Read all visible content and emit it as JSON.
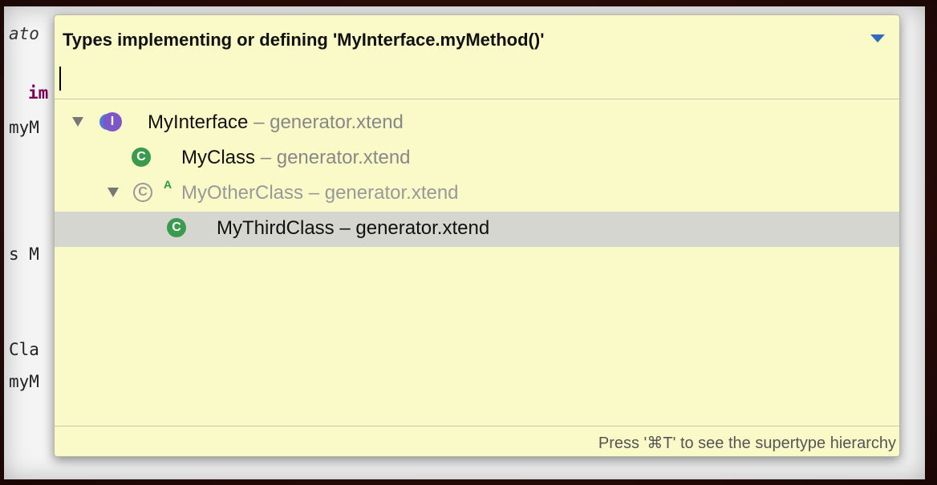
{
  "editor": {
    "lines": [
      "ato",
      "im",
      "myM",
      "s M",
      "Cla",
      "myM"
    ]
  },
  "popup": {
    "title": "Types implementing or defining 'MyInterface.myMethod()'",
    "filter_value": "",
    "status": "Press '⌘T' to see the supertype hierarchy",
    "items": [
      {
        "name": "MyInterface",
        "separator": "–",
        "location": "generator.xtend",
        "kind": "interface-icon",
        "expanded": true
      },
      {
        "name": "MyClass",
        "separator": "–",
        "location": "generator.xtend",
        "kind": "class-icon"
      },
      {
        "name": "MyOtherClass",
        "separator": "–",
        "location": "generator.xtend",
        "kind": "abstract-class-icon",
        "expanded": true,
        "abstract_mark": "A"
      },
      {
        "name": "MyThirdClass",
        "separator": "–",
        "location": "generator.xtend",
        "kind": "class-icon",
        "selected": true
      }
    ],
    "icon_glyphs": {
      "interface": "I",
      "class": "C"
    }
  },
  "colors": {
    "popup_bg": "#fafac8",
    "selection": "#d6d6d0",
    "class_icon": "#3a9a4e",
    "interface_icon": "#7d57c8",
    "menu_arrow": "#2f6cc0"
  }
}
